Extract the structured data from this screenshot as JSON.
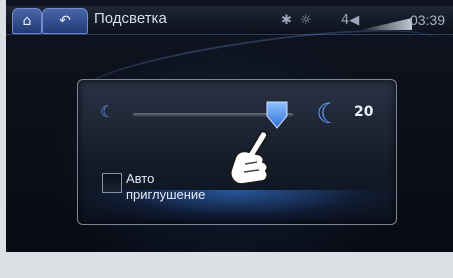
{
  "window": {
    "title": "Подсветка"
  },
  "topbar": {
    "home_icon": "home-icon",
    "back_icon": "back-icon",
    "status": {
      "bluetooth_icon": "bluetooth-icon",
      "brightness_icon": "sun-icon",
      "volume_icon": "speaker-icon",
      "time": "03:39"
    }
  },
  "brightness": {
    "value": "20",
    "level_fraction": 0.9,
    "min_icon": "moon-small-icon",
    "max_icon": "moon-large-icon"
  },
  "auto_dim": {
    "label_line1": "Авто",
    "label_line2": "приглушение",
    "checked": false
  },
  "colors": {
    "accent_blue": "#5fa0ff",
    "tab_blue": "#213a76"
  }
}
